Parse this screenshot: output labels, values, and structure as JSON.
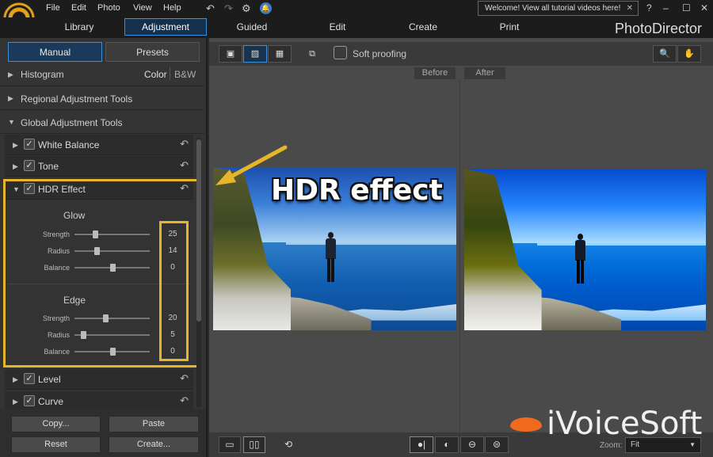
{
  "menu": [
    "File",
    "Edit",
    "Photo",
    "View",
    "Help"
  ],
  "notification": "Welcome! View all tutorial videos here!",
  "window_controls": {
    "help": "?",
    "minimize": "–",
    "maximize": "☐",
    "close": "✕"
  },
  "modes": {
    "library": "Library",
    "adjustment": "Adjustment",
    "guided": "Guided",
    "edit": "Edit",
    "create": "Create",
    "print": "Print"
  },
  "brand": "PhotoDirector",
  "panel_tabs": {
    "manual": "Manual",
    "presets": "Presets"
  },
  "sections": {
    "histogram": "Histogram",
    "color": "Color",
    "bw": "B&W",
    "regional": "Regional Adjustment Tools",
    "global": "Global Adjustment Tools"
  },
  "tools": {
    "white_balance": "White Balance",
    "tone": "Tone",
    "hdr": "HDR Effect",
    "level": "Level",
    "curve": "Curve"
  },
  "hdr": {
    "glow": {
      "title": "Glow",
      "strength_label": "Strength",
      "strength": "25",
      "radius_label": "Radius",
      "radius": "14",
      "balance_label": "Balance",
      "balance": "0"
    },
    "edge": {
      "title": "Edge",
      "strength_label": "Strength",
      "strength": "20",
      "radius_label": "Radius",
      "radius": "5",
      "balance_label": "Balance",
      "balance": "0"
    }
  },
  "buttons": {
    "copy": "Copy...",
    "paste": "Paste",
    "reset": "Reset",
    "create": "Create..."
  },
  "viewer": {
    "soft_proofing": "Soft proofing",
    "before": "Before",
    "after": "After",
    "overlay_text": "HDR effect"
  },
  "zoom": {
    "label": "Zoom:",
    "value": "Fit"
  },
  "watermark": "iVoiceSoft",
  "colors": {
    "accent_blue": "#3a8fd6",
    "highlight_yellow": "#e6b52a"
  }
}
